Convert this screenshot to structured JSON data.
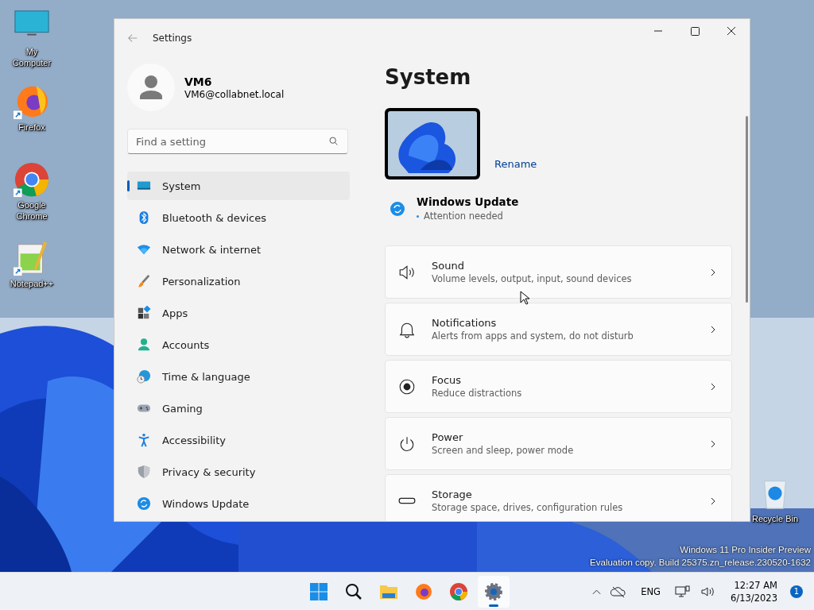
{
  "desktop_icons": [
    {
      "label": "My Computer",
      "kind": "computer",
      "shortcut": false
    },
    {
      "label": "Firefox",
      "kind": "firefox",
      "shortcut": true
    },
    {
      "label": "Google Chrome",
      "kind": "chrome",
      "shortcut": true
    },
    {
      "label": "Notepad++",
      "kind": "notepad",
      "shortcut": true
    },
    {
      "label": "Recycle Bin",
      "kind": "recycle",
      "shortcut": false
    }
  ],
  "window": {
    "title": "Settings"
  },
  "account": {
    "name": "VM6",
    "email": "VM6@collabnet.local"
  },
  "search": {
    "placeholder": "Find a setting"
  },
  "sidebar": {
    "items": [
      {
        "label": "System",
        "kind": "system",
        "selected": true
      },
      {
        "label": "Bluetooth & devices",
        "kind": "bluetooth",
        "selected": false
      },
      {
        "label": "Network & internet",
        "kind": "network",
        "selected": false
      },
      {
        "label": "Personalization",
        "kind": "brush",
        "selected": false
      },
      {
        "label": "Apps",
        "kind": "apps",
        "selected": false
      },
      {
        "label": "Accounts",
        "kind": "accounts",
        "selected": false
      },
      {
        "label": "Time & language",
        "kind": "time",
        "selected": false
      },
      {
        "label": "Gaming",
        "kind": "gaming",
        "selected": false
      },
      {
        "label": "Accessibility",
        "kind": "accessibility",
        "selected": false
      },
      {
        "label": "Privacy & security",
        "kind": "privacy",
        "selected": false
      },
      {
        "label": "Windows Update",
        "kind": "update",
        "selected": false
      }
    ]
  },
  "page": {
    "heading": "System",
    "rename": "Rename",
    "update": {
      "title": "Windows Update",
      "status": "Attention needed"
    },
    "cards": [
      {
        "title": "Sound",
        "subtitle": "Volume levels, output, input, sound devices",
        "kind": "sound"
      },
      {
        "title": "Notifications",
        "subtitle": "Alerts from apps and system, do not disturb",
        "kind": "bell"
      },
      {
        "title": "Focus",
        "subtitle": "Reduce distractions",
        "kind": "focus"
      },
      {
        "title": "Power",
        "subtitle": "Screen and sleep, power mode",
        "kind": "power"
      },
      {
        "title": "Storage",
        "subtitle": "Storage space, drives, configuration rules",
        "kind": "storage"
      }
    ]
  },
  "watermark": [
    "Windows 11 Pro Insider Preview",
    "Evaluation copy. Build 25375.zn_release.230520-1632"
  ],
  "taskbar": {
    "apps": [
      {
        "kind": "start",
        "selected": false
      },
      {
        "kind": "search",
        "selected": false
      },
      {
        "kind": "folder",
        "selected": false
      },
      {
        "kind": "firefox",
        "selected": false
      },
      {
        "kind": "chrome",
        "selected": false
      },
      {
        "kind": "settings",
        "selected": true
      }
    ],
    "language": "ENG",
    "time": "12:27 AM",
    "date": "6/13/2023",
    "notifications": "1"
  }
}
